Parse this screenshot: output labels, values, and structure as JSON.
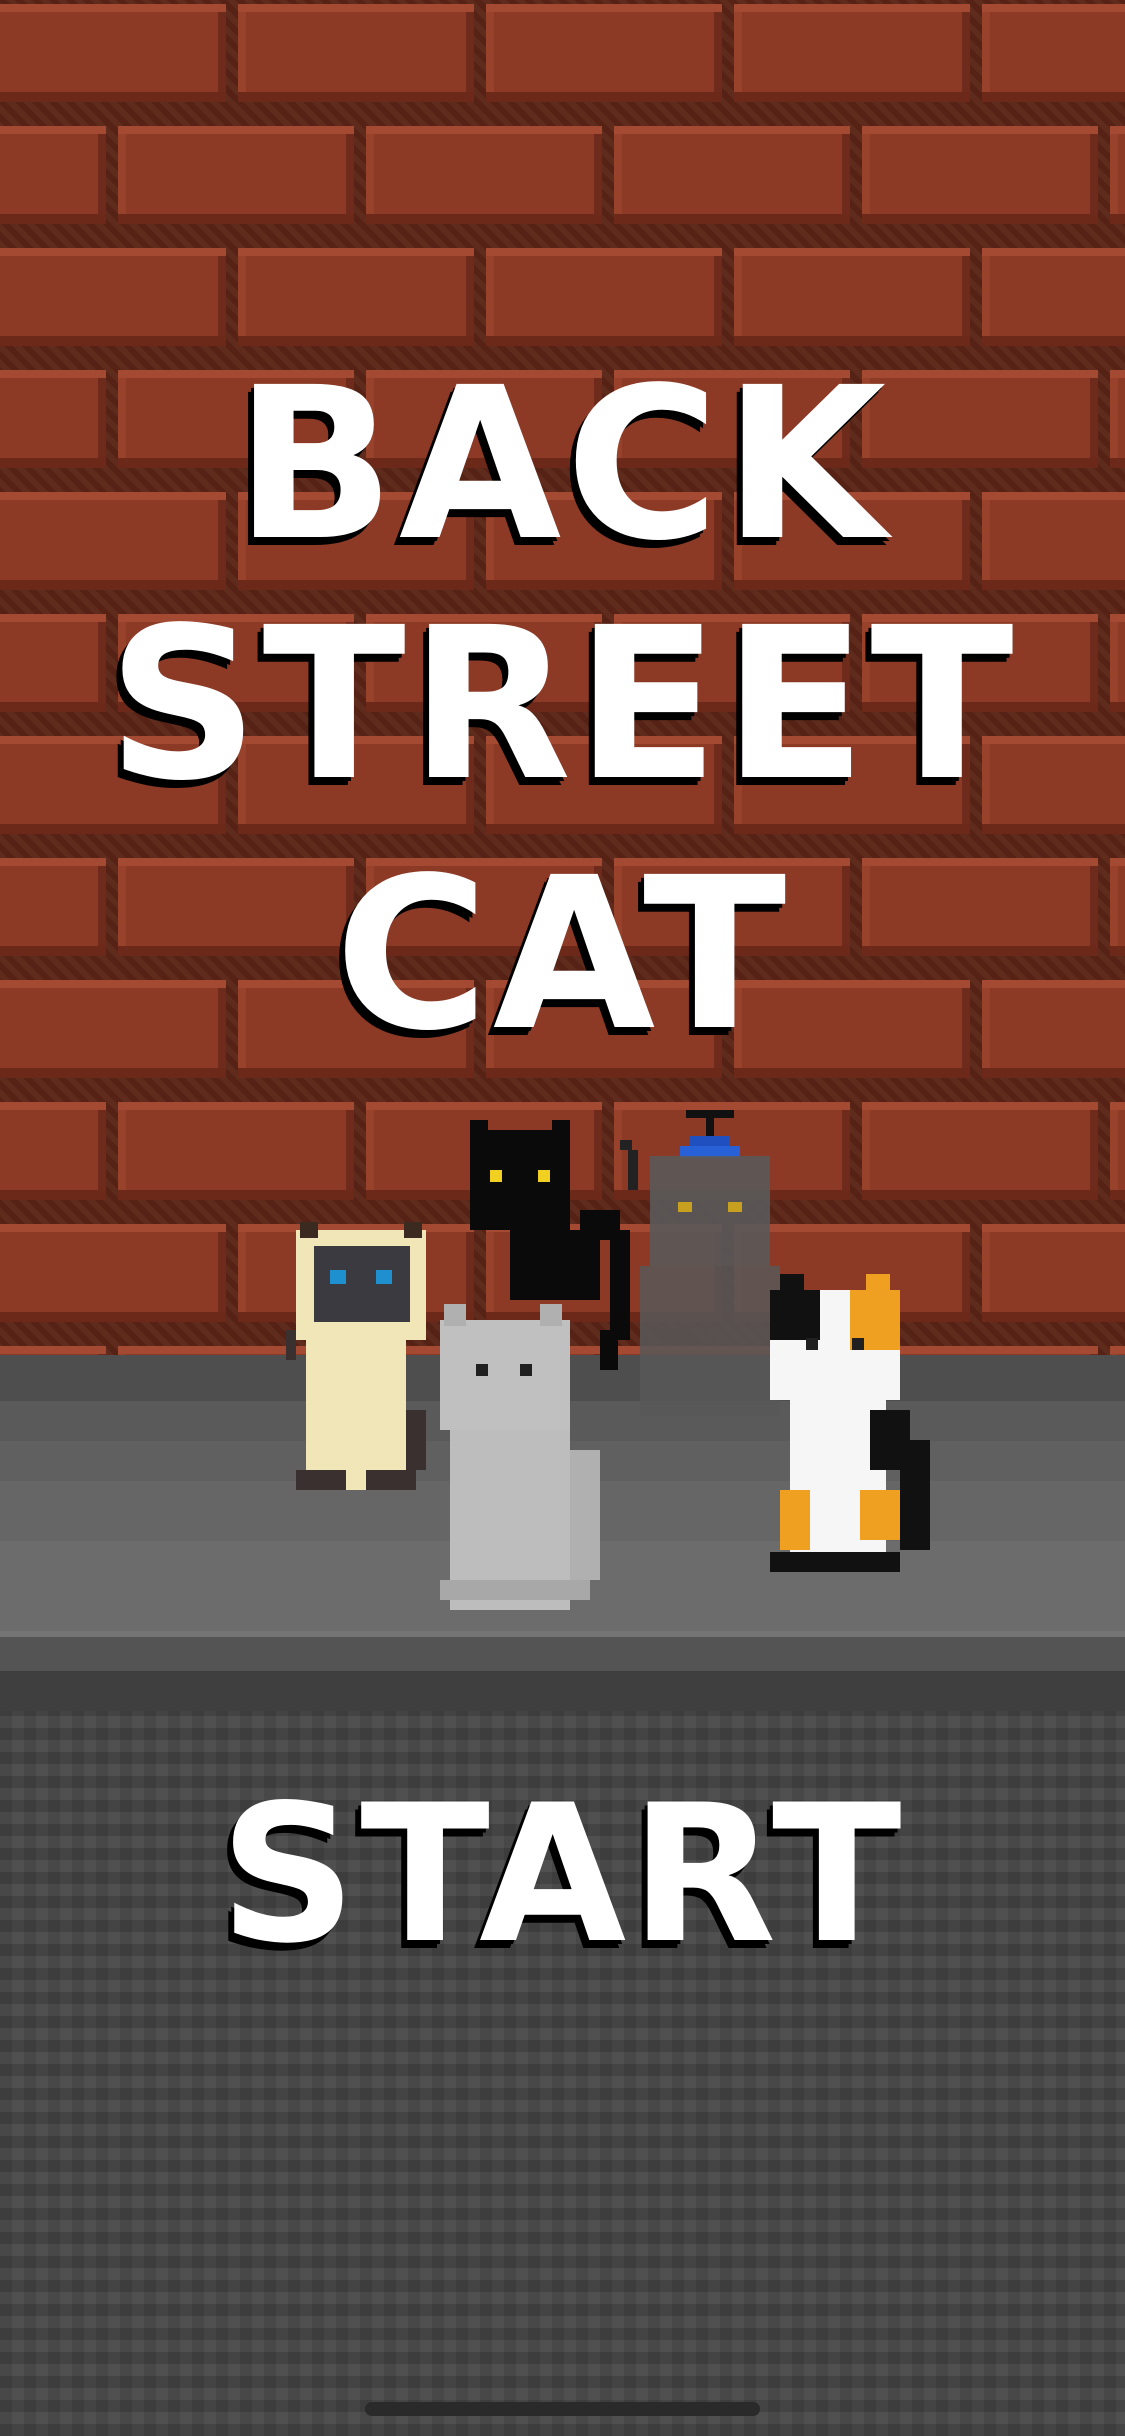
{
  "game": {
    "title_lines": [
      "BACK",
      "STREET",
      "CAT"
    ],
    "start_label": "START"
  },
  "scene": {
    "wall": "brick-wall",
    "ground": "sidewalk-and-asphalt",
    "cats": [
      {
        "name": "siamese-cat",
        "eye_color": "#1e90d0"
      },
      {
        "name": "black-cat",
        "eye_color": "#f0d020"
      },
      {
        "name": "gray-ghost-cat-with-propeller-hat",
        "eye_color": "#c8a020"
      },
      {
        "name": "light-gray-cat",
        "eye_color": "#202020"
      },
      {
        "name": "calico-cat",
        "eye_color": "#202020"
      }
    ]
  },
  "colors": {
    "brick": "#8c3a26",
    "mortar": "#5a2416",
    "title_text": "#ffffff",
    "title_shadow": "#000000",
    "sidewalk": "#666666",
    "asphalt": "#464646"
  }
}
